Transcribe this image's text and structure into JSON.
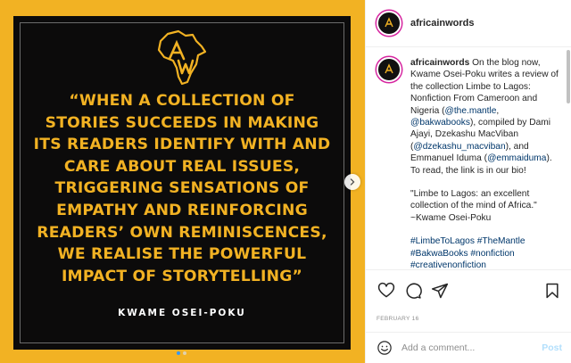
{
  "post": {
    "quote": "“WHEN A COLLECTION OF STORIES SUCCEEDS IN MAKING ITS READERS IDENTIFY WITH AND CARE ABOUT REAL ISSUES, TRIGGERING SENSATIONS OF EMPATHY AND REINFORCING READERS’ OWN REMINISCENCES, WE REALISE THE POWERFUL IMPACT OF STORYTELLING”",
    "author": "KWAME OSEI-POKU",
    "logo_letters": "AW",
    "carousel_dots": 2,
    "carousel_active": 1
  },
  "account": {
    "username": "africainwords"
  },
  "caption": {
    "username": "africainwords",
    "intro": " On the blog now, Kwame Osei-Poku writes a review of the collection Limbe to Lagos: Nonfiction From Cameroon and Nigeria (",
    "mention1": "@the.mantle",
    "sep1": ", ",
    "mention2": "@bakwabooks",
    "mid1": "), compiled by Dami Ajayi, Dzekashu MacViban (",
    "mention3": "@dzekashu_macviban",
    "mid2": "), and Emmanuel Iduma (",
    "mention4": "@emmaiduma",
    "outro": "). To read, the link is in our bio!",
    "pull_quote": "\"Limbe to Lagos: an excellent collection of the mind of Africa.\" ~Kwame Osei-Poku",
    "hashtags": "#LimbeToLagos #TheMantle #BakwaBooks #nonfiction #creativenonfiction #EmmanuelIduma #DamiAjayi #DzekashuMacViban #africanliterature #books"
  },
  "meta": {
    "date": "FEBRUARY 16"
  },
  "comment": {
    "placeholder": "Add a comment...",
    "post_label": "Post"
  },
  "colors": {
    "background_gold": "#f2b223",
    "card_black": "#0c0b0b",
    "link": "#00376b",
    "post_button": "#b2dffc"
  },
  "icons": [
    "africa-logo-icon",
    "chevron-right-icon",
    "heart-icon",
    "comment-icon",
    "share-icon",
    "bookmark-icon",
    "emoji-icon"
  ]
}
